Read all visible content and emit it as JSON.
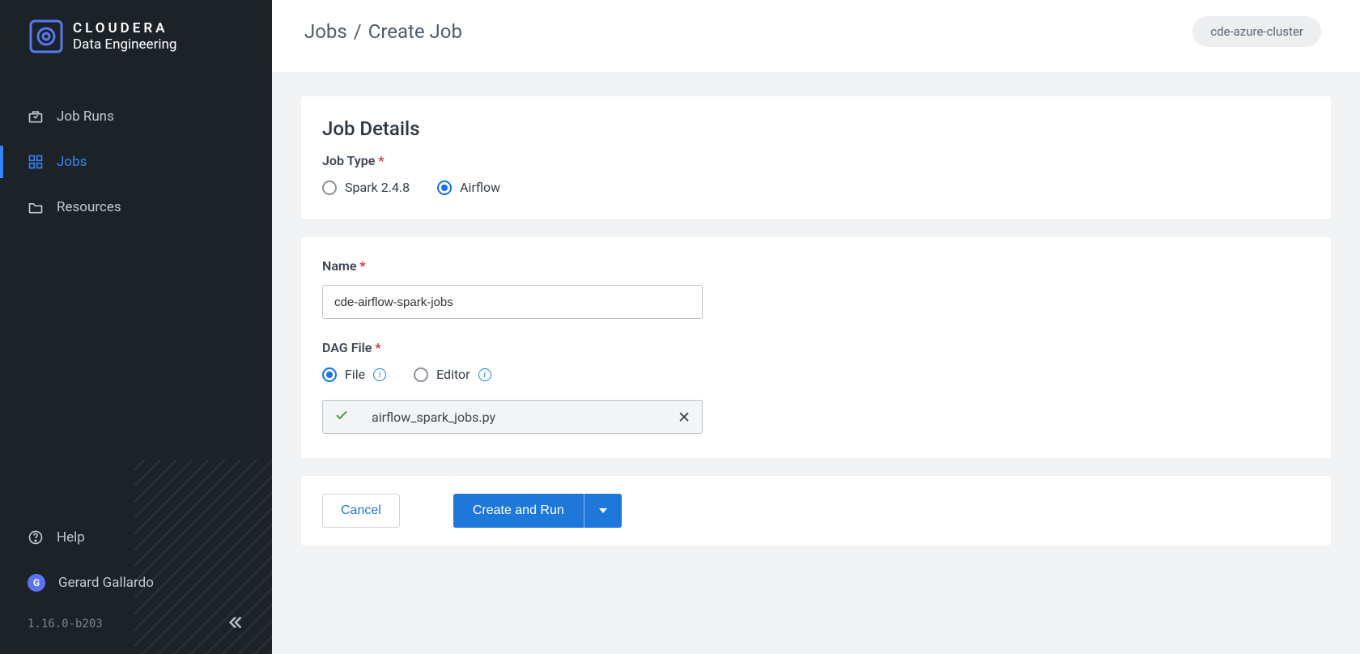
{
  "brand": {
    "name": "CLOUDERA",
    "product": "Data Engineering"
  },
  "sidebar": {
    "items": [
      {
        "label": "Job Runs"
      },
      {
        "label": "Jobs"
      },
      {
        "label": "Resources"
      }
    ],
    "help_label": "Help",
    "version": "1.16.0-b203"
  },
  "user": {
    "name": "Gerard Gallardo",
    "initial": "G"
  },
  "breadcrumb": {
    "root": "Jobs",
    "current": "Create Job"
  },
  "cluster": "cde-azure-cluster",
  "form": {
    "section_title": "Job Details",
    "job_type": {
      "label": "Job Type",
      "options": [
        {
          "label": "Spark 2.4.8"
        },
        {
          "label": "Airflow"
        }
      ],
      "selected": "Airflow"
    },
    "name": {
      "label": "Name",
      "value": "cde-airflow-spark-jobs"
    },
    "dag": {
      "label": "DAG File",
      "mode_options": [
        {
          "label": "File"
        },
        {
          "label": "Editor"
        }
      ],
      "selected": "File",
      "filename": "airflow_spark_jobs.py"
    }
  },
  "actions": {
    "cancel": "Cancel",
    "primary": "Create and Run"
  }
}
